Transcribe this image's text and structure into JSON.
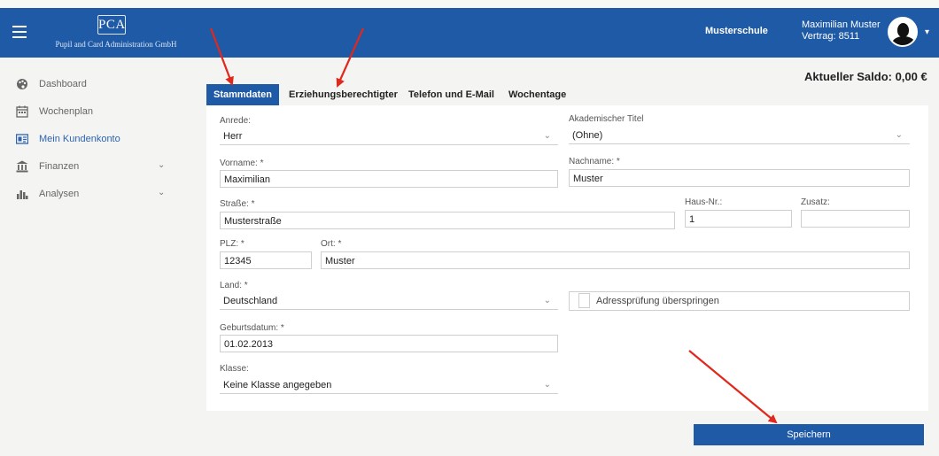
{
  "header": {
    "logo_mark": "PCA",
    "logo_subtitle": "Pupil and Card Administration GmbH",
    "school": "Musterschule",
    "user_name": "Maximilian Muster",
    "contract": "Vertrag: 8511",
    "brand_color": "#1f5aa6"
  },
  "sidebar": {
    "items": [
      {
        "label": "Dashboard",
        "icon": "palette-icon"
      },
      {
        "label": "Wochenplan",
        "icon": "calendar-icon"
      },
      {
        "label": "Mein Kundenkonto",
        "icon": "id-card-icon"
      },
      {
        "label": "Finanzen",
        "icon": "bank-icon"
      },
      {
        "label": "Analysen",
        "icon": "bar-chart-icon"
      }
    ]
  },
  "saldo": "Aktueller Saldo: 0,00 €",
  "tabs": [
    "Stammdaten",
    "Erziehungsberechtigter",
    "Telefon und E-Mail",
    "Wochentage"
  ],
  "form": {
    "anrede": {
      "label": "Anrede:",
      "value": "Herr"
    },
    "titel": {
      "label": "Akademischer Titel",
      "value": "(Ohne)"
    },
    "vorname": {
      "label": "Vorname: *",
      "value": "Maximilian"
    },
    "nachname": {
      "label": "Nachname: *",
      "value": "Muster"
    },
    "strasse": {
      "label": "Straße: *",
      "value": "Musterstraße"
    },
    "hausnr": {
      "label": "Haus-Nr.:",
      "value": "1"
    },
    "zusatz": {
      "label": "Zusatz:",
      "value": ""
    },
    "plz": {
      "label": "PLZ: *",
      "value": "12345"
    },
    "ort": {
      "label": "Ort: *",
      "value": "Muster"
    },
    "land": {
      "label": "Land: *",
      "value": "Deutschland"
    },
    "adresspruefung": {
      "label": "Adressprüfung überspringen"
    },
    "geburtsdatum": {
      "label": "Geburtsdatum: *",
      "value": "01.02.2013"
    },
    "klasse": {
      "label": "Klasse:",
      "value": "Keine Klasse angegeben"
    }
  },
  "save_label": "Speichern",
  "annotation_color": "#e0281c"
}
